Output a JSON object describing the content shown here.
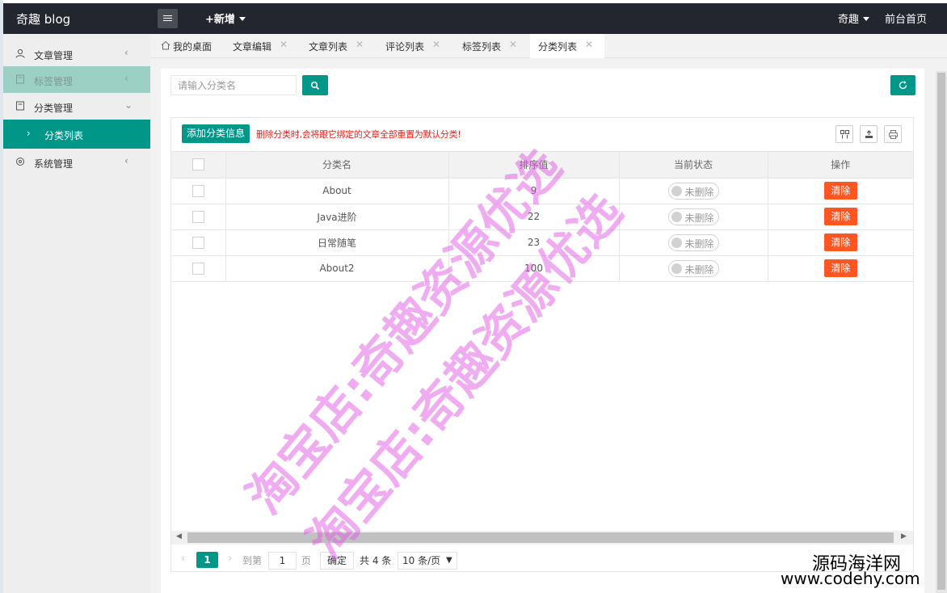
{
  "app": {
    "title": "奇趣 blog",
    "add_new": "+新增",
    "user": "奇趣",
    "front_home": "前台首页"
  },
  "sidebar": {
    "items": [
      {
        "label": "文章管理",
        "icon": "user-icon"
      },
      {
        "label": "标签管理",
        "icon": "tag-icon"
      },
      {
        "label": "分类管理",
        "icon": "folder-icon"
      },
      {
        "label": "分类列表",
        "icon": "chevron-right-icon"
      },
      {
        "label": "系统管理",
        "icon": "settings-icon"
      }
    ]
  },
  "tabs": {
    "home": "我的桌面",
    "items": [
      "文章编辑",
      "文章列表",
      "评论列表",
      "标签列表",
      "分类列表"
    ],
    "active": "分类列表"
  },
  "search": {
    "placeholder": "请输入分类名"
  },
  "toolbar": {
    "add_label": "添加分类信息",
    "warning": "删除分类时,会将跟它绑定的文章全部重置为默认分类!"
  },
  "table": {
    "columns": [
      "分类名",
      "排序值",
      "当前状态",
      "操作"
    ],
    "rows": [
      {
        "name": "About",
        "order": "9",
        "status": "未删除",
        "action": "清除"
      },
      {
        "name": "Java进阶",
        "order": "22",
        "status": "未删除",
        "action": "清除"
      },
      {
        "name": "日常随笔",
        "order": "23",
        "status": "未删除",
        "action": "清除"
      },
      {
        "name": "About2",
        "order": "100",
        "status": "未删除",
        "action": "清除"
      }
    ]
  },
  "pagination": {
    "current_page": "1",
    "goto_label": "到第",
    "page_input": "1",
    "page_unit": "页",
    "confirm": "确定",
    "total": "共 4 条",
    "page_size": "10 条/页"
  },
  "watermark": {
    "text": "淘宝店:奇趣资源优选"
  },
  "corner": {
    "line1": "源码海洋网",
    "line2": "www.codehy.com"
  },
  "colors": {
    "accent": "#009688",
    "danger": "#ff5722",
    "topbar": "#23262e",
    "warning_text": "#e2231a"
  }
}
